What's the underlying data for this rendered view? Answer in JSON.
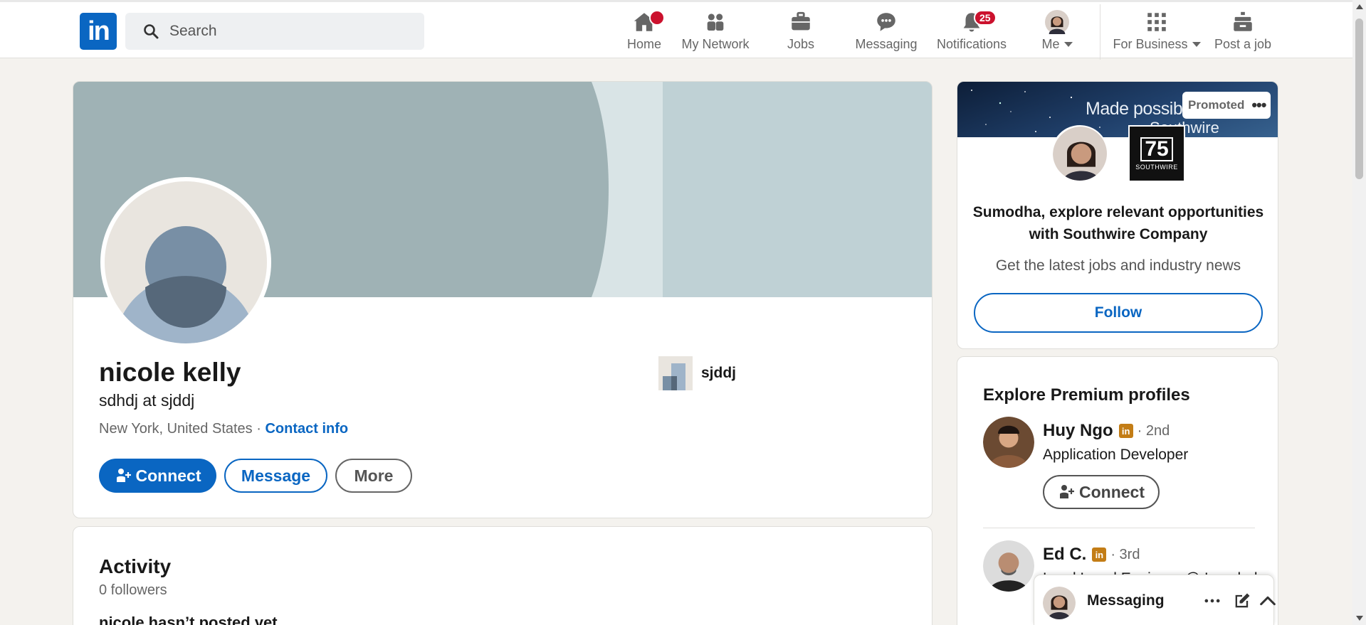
{
  "nav": {
    "search_placeholder": "Search",
    "home": "Home",
    "home_badge": "",
    "network": "My Network",
    "jobs": "Jobs",
    "messaging": "Messaging",
    "notifications": "Notifications",
    "notifications_badge": "25",
    "me": "Me",
    "for_business": "For Business",
    "post_job": "Post a job"
  },
  "profile": {
    "name": "nicole kelly",
    "headline": "sdhdj at sjddj",
    "location": "New York, United States · ",
    "contact_info": "Contact info",
    "company": "sjddj",
    "connect": "Connect",
    "message": "Message",
    "more": "More"
  },
  "activity": {
    "title": "Activity",
    "followers": "0 followers",
    "empty": "nicole hasn’t posted yet"
  },
  "ad": {
    "banner_text_1": "Made possible",
    "banner_text_2": "Southwire",
    "promoted": "Promoted",
    "logo_text": "75",
    "logo_sub": "SOUTHWIRE",
    "title": "Sumodha, explore relevant opportunities with Southwire Company",
    "subtitle": "Get the latest jobs and industry news",
    "follow": "Follow"
  },
  "premium": {
    "title": "Explore Premium profiles",
    "people": [
      {
        "name": "Huy Ngo",
        "degree": "· 2nd",
        "role": "Application Developer",
        "connect": "Connect"
      },
      {
        "name": "Ed C.",
        "degree": "· 3rd",
        "role": "Lead Legal Engineer @ Ironclad"
      }
    ]
  },
  "messaging_bar": {
    "title": "Messaging"
  },
  "colors": {
    "brand": "#0a66c2",
    "badge": "#cb112d",
    "premium": "#c37d16"
  }
}
